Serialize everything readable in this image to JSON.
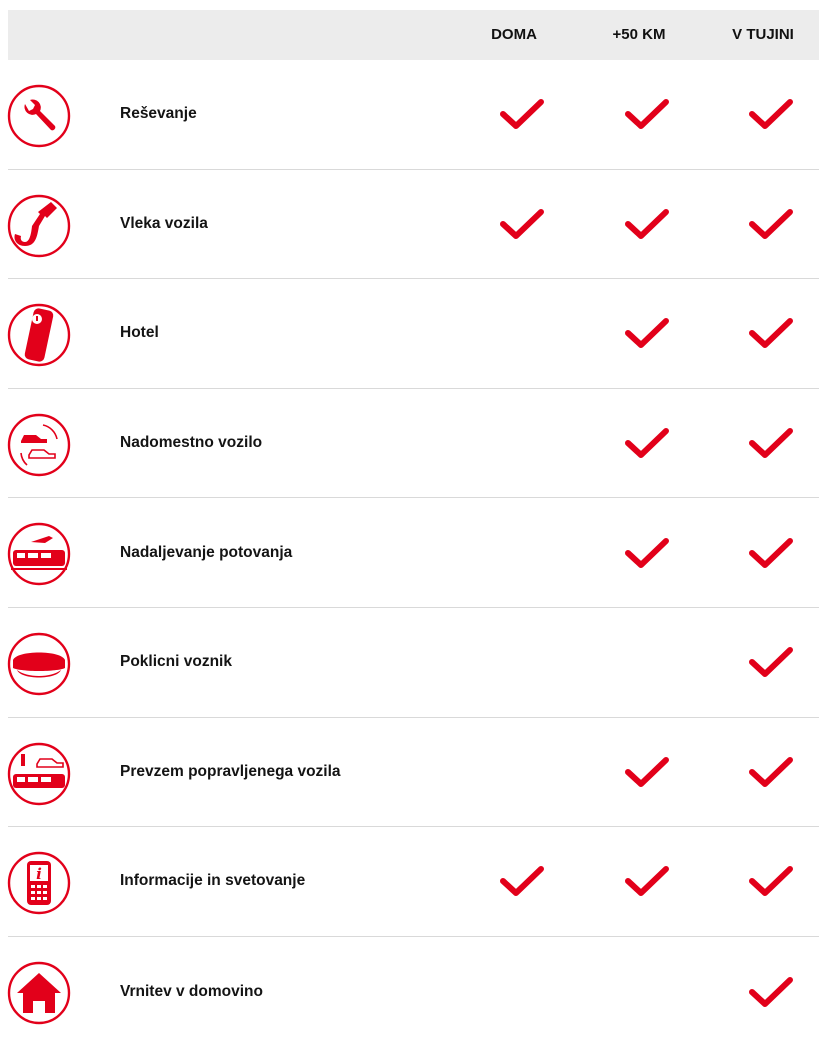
{
  "columns": [
    "DOMA",
    "+50 KM",
    "V TUJINI"
  ],
  "accent": "#e2001a",
  "rows": [
    {
      "label": "Reševanje",
      "icon": "wrench-icon",
      "checks": [
        true,
        true,
        true
      ]
    },
    {
      "label": "Vleka vozila",
      "icon": "tow-hook-icon",
      "checks": [
        true,
        true,
        true
      ]
    },
    {
      "label": "Hotel",
      "icon": "hotel-door-tag-icon",
      "checks": [
        false,
        true,
        true
      ]
    },
    {
      "label": "Nadomestno vozilo",
      "icon": "replacement-car-icon",
      "checks": [
        false,
        true,
        true
      ]
    },
    {
      "label": "Nadaljevanje potovanja",
      "icon": "plane-train-icon",
      "checks": [
        false,
        true,
        true
      ]
    },
    {
      "label": "Poklicni voznik",
      "icon": "driver-cap-icon",
      "checks": [
        false,
        false,
        true
      ]
    },
    {
      "label": "Prevzem popravljenega vozila",
      "icon": "pickup-vehicle-icon",
      "checks": [
        false,
        true,
        true
      ]
    },
    {
      "label": "Informacije in svetovanje",
      "icon": "info-phone-icon",
      "checks": [
        true,
        true,
        true
      ]
    },
    {
      "label": "Vrnitev v domovino",
      "icon": "home-icon",
      "checks": [
        false,
        false,
        true
      ]
    }
  ]
}
